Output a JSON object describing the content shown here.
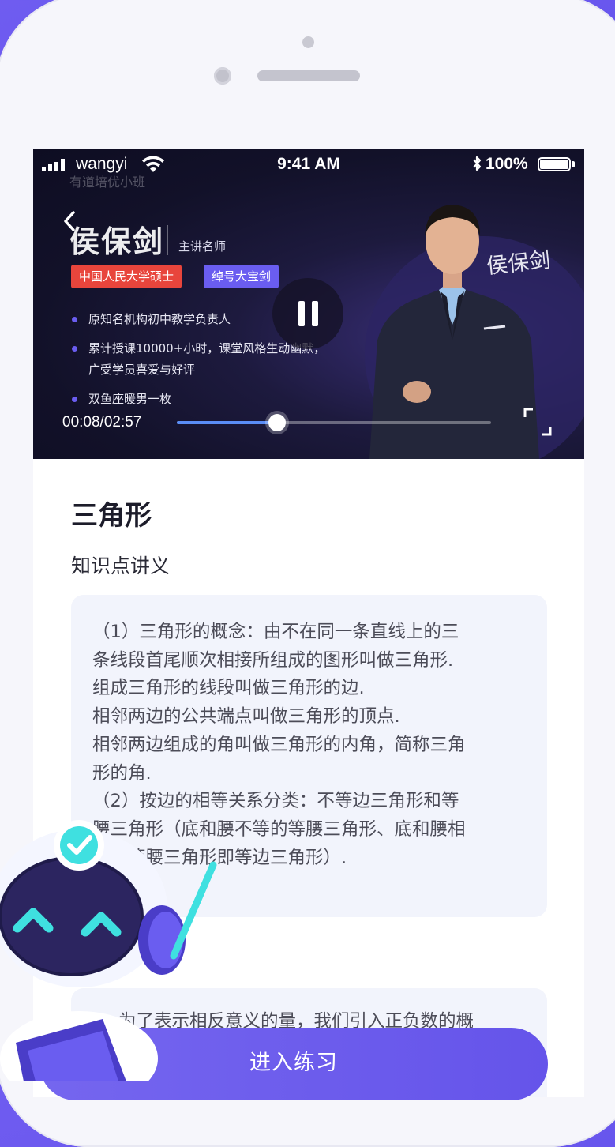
{
  "status_bar": {
    "carrier": "wangyi",
    "time": "9:41 AM",
    "battery": "100%"
  },
  "video": {
    "watermark": "有道培优小班",
    "teacher_name": "侯保剑",
    "teacher_title": "主讲名师",
    "badges": [
      "中国人民大学硕士",
      "绰号大宝剑"
    ],
    "bullets": [
      "原知名机构初中教学负责人",
      "累计授课10000+小时，课堂风格生动幽默，\n广受学员喜爱与好评",
      "双鱼座暖男一枚"
    ],
    "signature": "侯保剑",
    "time_display": "00:08/02:57",
    "progress": 0.318
  },
  "lesson": {
    "title": "三角形",
    "section": "知识点讲义",
    "text": "（1）三角形的概念：由不在同一条直线上的三\n条线段首尾顺次相接所组成的图形叫做三角形.\n组成三角形的线段叫做三角形的边.\n相邻两边的公共端点叫做三角形的顶点.\n相邻两边组成的角叫做三角形的内角，简称三角\n形的角.\n（2）按边的相等关系分类：不等边三角形和等\n腰三角形（底和腰不等的等腰三角形、底和腰相\n等的等腰三角形即等边三角形）.",
    "next_text": "为了表示相反意义的量，我们引入正负数的概"
  },
  "cta_label": "进入练习",
  "colors": {
    "accent": "#6554ea",
    "badge_red": "#e8453c",
    "progress": "#5a8df6"
  }
}
